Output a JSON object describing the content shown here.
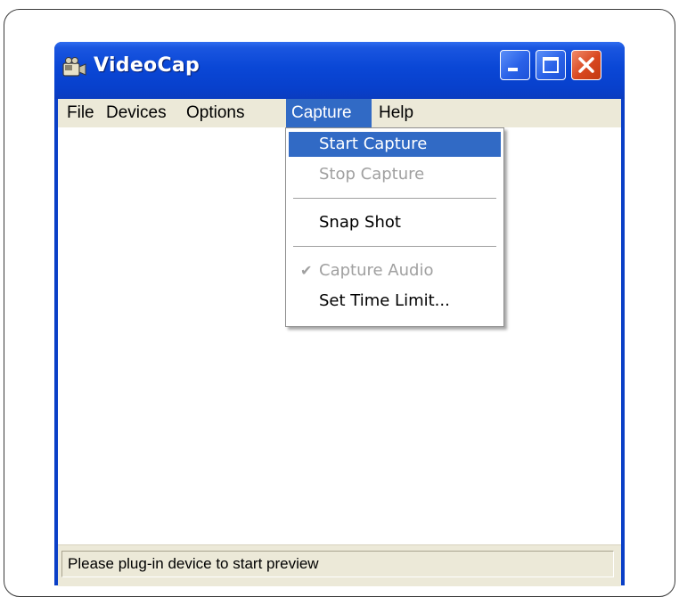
{
  "window": {
    "title": "VideoCap",
    "app_icon": "camcorder-icon",
    "controls": [
      "minimize-icon",
      "maximize-icon",
      "close-icon"
    ]
  },
  "menubar": {
    "items": [
      {
        "label": "File"
      },
      {
        "label": "Devices"
      },
      {
        "label": "Options"
      },
      {
        "label": "Capture",
        "active": true
      },
      {
        "label": "Help"
      }
    ]
  },
  "capture_menu": {
    "items": [
      {
        "label": "Start Capture",
        "state": "highlighted"
      },
      {
        "label": "Stop Capture",
        "state": "disabled"
      },
      {
        "label": "Snap Shot",
        "state": "enabled"
      },
      {
        "label": "Capture Audio",
        "state": "disabled",
        "checked": true
      },
      {
        "label": "Set Time Limit...",
        "state": "enabled"
      }
    ]
  },
  "status": {
    "text": "Please plug-in device to start preview"
  },
  "colors": {
    "titlebar": "#0a47d6",
    "menu_highlight": "#316ac5",
    "chrome": "#ece9d8",
    "close_button": "#d8471f"
  }
}
